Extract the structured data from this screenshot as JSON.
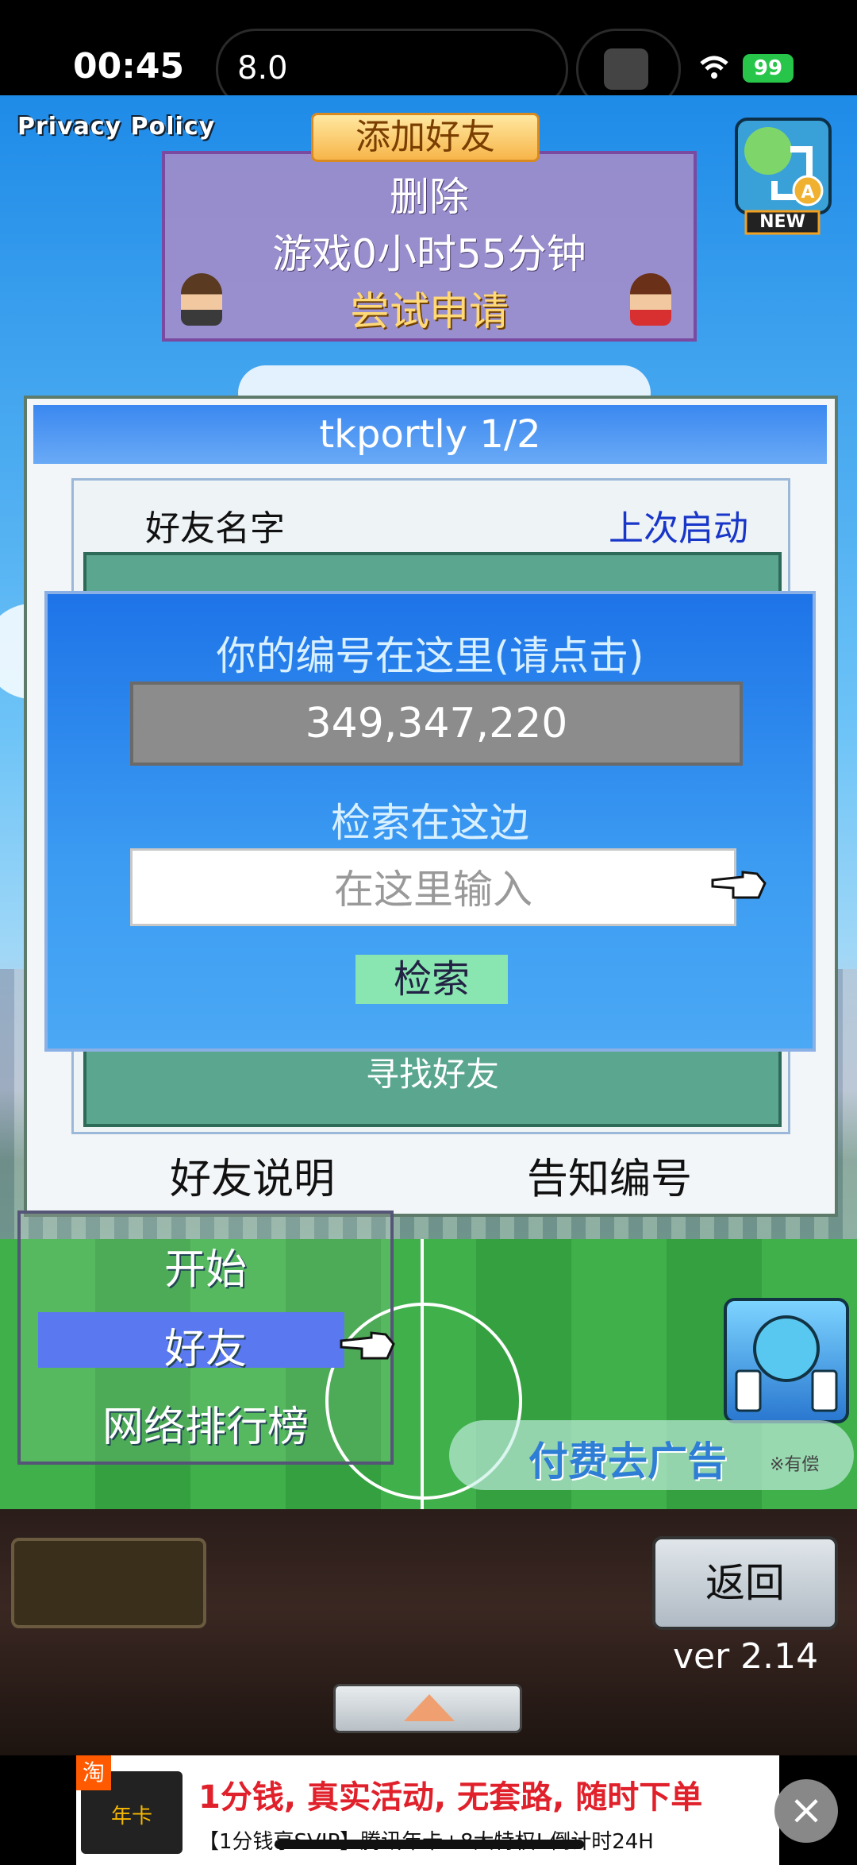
{
  "status_bar": {
    "time": "00:45",
    "island_text": "8.0",
    "battery": "99"
  },
  "header": {
    "privacy_policy": "Privacy Policy",
    "add_friend_tab": "添加好友",
    "delete": "删除",
    "playtime": "游戏0小时55分钟",
    "apply": "尝试申请",
    "new_badge": "NEW"
  },
  "dialog": {
    "title": "tkportly 1/2",
    "col_friend_name": "好友名字",
    "col_last_launch": "上次启动",
    "find_friend": "寻找好友",
    "friend_help": "好友说明",
    "notify_id": "告知编号"
  },
  "id_panel": {
    "your_id_label": "你的编号在这里(请点击)",
    "your_id_value": "349,347,220",
    "search_label": "检索在这边",
    "search_placeholder": "在这里输入",
    "search_button": "检索"
  },
  "menu": {
    "items": [
      "开始",
      "好友",
      "网络排行榜"
    ],
    "selected": "好友"
  },
  "ad_free": {
    "label": "付费去广告",
    "note": "※有偿"
  },
  "bottom": {
    "back": "返回",
    "version": "ver 2.14"
  },
  "ad_banner": {
    "store_badge": "淘",
    "thumb_text": "年卡",
    "title": "1分钱, 真实活动, 无套路, 随时下单",
    "subtitle": "【1分钱享SVIP】腾讯年卡+8大特权! 倒计时24H"
  },
  "colors": {
    "accent_blue": "#1e74e8",
    "list_green": "#5aa68f",
    "selected_menu": "#5a78f0"
  }
}
